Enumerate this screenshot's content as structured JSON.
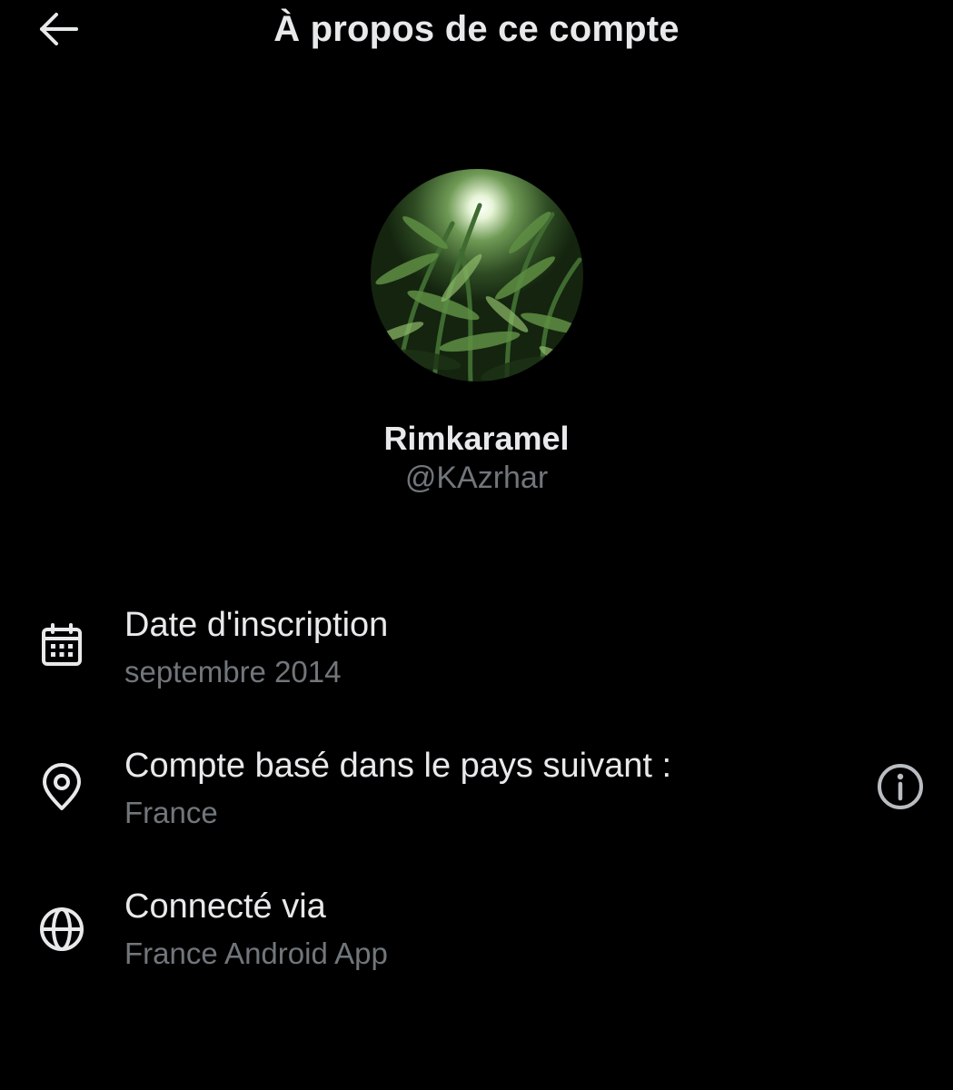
{
  "header": {
    "title": "À propos de ce compte",
    "back_icon": "arrow-left-icon"
  },
  "profile": {
    "display_name": "Rimkaramel",
    "handle": "@KAzrhar",
    "avatar": "avatar-photo-green-foliage"
  },
  "details": [
    {
      "icon": "calendar-icon",
      "label": "Date d'inscription",
      "value": "septembre 2014"
    },
    {
      "icon": "location-pin-icon",
      "label": "Compte basé dans le pays suivant :",
      "value": "France",
      "action_icon": "info-icon"
    },
    {
      "icon": "globe-icon",
      "label": "Connecté via",
      "value": "France Android App"
    }
  ],
  "colors": {
    "background": "#000000",
    "primary_text": "#e7e9ea",
    "secondary_text": "#71767b"
  }
}
